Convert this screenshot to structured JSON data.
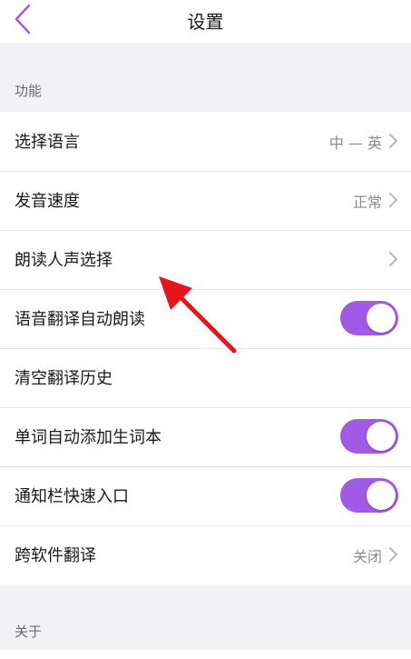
{
  "header": {
    "title": "设置"
  },
  "sections": {
    "function_label": "功能",
    "about_label": "关于"
  },
  "rows": {
    "select_language": {
      "label": "选择语言",
      "value": "中 — 英"
    },
    "speech_rate": {
      "label": "发音速度",
      "value": "正常"
    },
    "voice_select": {
      "label": "朗读人声选择"
    },
    "auto_read": {
      "label": "语音翻译自动朗读",
      "on": true
    },
    "clear_history": {
      "label": "清空翻译历史"
    },
    "auto_add_words": {
      "label": "单词自动添加生词本",
      "on": true
    },
    "notify_bar": {
      "label": "通知栏快速入口",
      "on": true
    },
    "cross_app": {
      "label": "跨软件翻译",
      "value": "关闭"
    }
  },
  "colors": {
    "accent": "#a05ae6",
    "annotation_arrow": "#e8141b"
  },
  "icons": {
    "back": "chevron-left-icon",
    "row_chevron": "chevron-right-icon"
  }
}
